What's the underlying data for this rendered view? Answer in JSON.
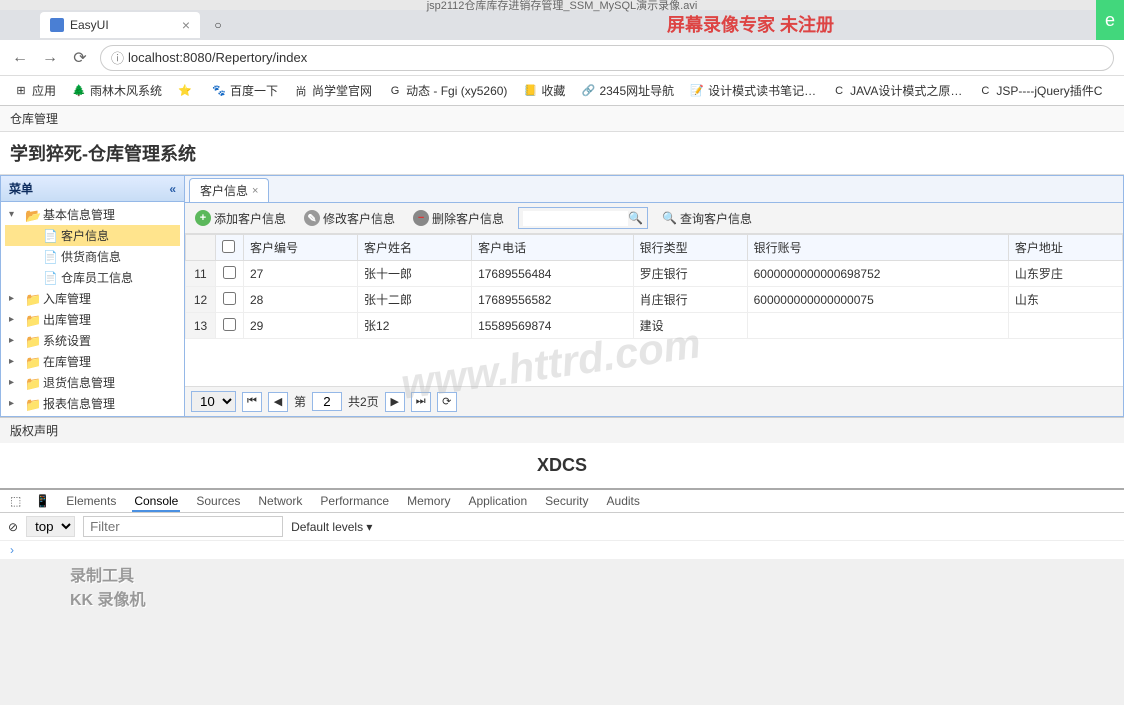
{
  "video_title": "jsp2112仓库库存进销存管理_SSM_MySQL演示录像.avi",
  "watermark_top": "屏幕录像专家  未注册",
  "browser": {
    "tab_title": "EasyUI",
    "url": "localhost:8080/Repertory/index"
  },
  "bookmarks": [
    {
      "icon": "⊞",
      "label": "应用"
    },
    {
      "icon": "🌲",
      "label": "雨林木风系统"
    },
    {
      "icon": "⭐",
      "label": ""
    },
    {
      "icon": "🐾",
      "label": "百度一下"
    },
    {
      "icon": "尚",
      "label": "尚学堂官网"
    },
    {
      "icon": "G",
      "label": "动态 - Fgi (xy5260)"
    },
    {
      "icon": "📒",
      "label": "收藏"
    },
    {
      "icon": "🔗",
      "label": "2345网址导航"
    },
    {
      "icon": "📝",
      "label": "设计模式读书笔记…"
    },
    {
      "icon": "C",
      "label": "JAVA设计模式之原…"
    },
    {
      "icon": "C",
      "label": "JSP----jQuery插件C"
    }
  ],
  "app_menu": "仓库管理",
  "app_title": "学到猝死-仓库管理系统",
  "sidebar": {
    "header": "菜单",
    "nodes": [
      {
        "level": 1,
        "toggle": "▾",
        "type": "folder-open",
        "label": "基本信息管理"
      },
      {
        "level": 2,
        "toggle": "",
        "type": "file",
        "label": "客户信息",
        "selected": true
      },
      {
        "level": 2,
        "toggle": "",
        "type": "file",
        "label": "供货商信息"
      },
      {
        "level": 2,
        "toggle": "",
        "type": "file",
        "label": "仓库员工信息"
      },
      {
        "level": 1,
        "toggle": "▸",
        "type": "folder-closed",
        "label": "入库管理"
      },
      {
        "level": 1,
        "toggle": "▸",
        "type": "folder-closed",
        "label": "出库管理"
      },
      {
        "level": 1,
        "toggle": "▸",
        "type": "folder-closed",
        "label": "系统设置"
      },
      {
        "level": 1,
        "toggle": "▸",
        "type": "folder-closed",
        "label": "在库管理"
      },
      {
        "level": 1,
        "toggle": "▸",
        "type": "folder-closed",
        "label": "退货信息管理"
      },
      {
        "level": 1,
        "toggle": "▸",
        "type": "folder-closed",
        "label": "报表信息管理"
      }
    ]
  },
  "content_tab": "客户信息",
  "toolbar": {
    "add": "添加客户信息",
    "edit": "修改客户信息",
    "del": "删除客户信息",
    "search": "查询客户信息"
  },
  "columns": [
    "客户编号",
    "客户姓名",
    "客户电话",
    "银行类型",
    "银行账号",
    "客户地址"
  ],
  "rows": [
    {
      "n": "11",
      "id": "27",
      "name": "张十一郎",
      "phone": "17689556484",
      "bank": "罗庄银行",
      "acct": "6000000000000698752",
      "addr": "山东罗庄"
    },
    {
      "n": "12",
      "id": "28",
      "name": "张十二郎",
      "phone": "17689556582",
      "bank": "肖庄银行",
      "acct": "600000000000000075",
      "addr": "山东"
    },
    {
      "n": "13",
      "id": "29",
      "name": "张12",
      "phone": "15589569874",
      "bank": "建设",
      "acct": "",
      "addr": ""
    }
  ],
  "pagination": {
    "page_size": "10",
    "page_label_prefix": "第",
    "page": "2",
    "total_label": "共2页"
  },
  "copyright": "版权声明",
  "footer_brand": "XDCS",
  "watermark_mid": "www.httrd.com",
  "watermark_bl1": "录制工具",
  "watermark_bl2": "KK 录像机",
  "devtools": {
    "tabs": [
      "Elements",
      "Console",
      "Sources",
      "Network",
      "Performance",
      "Memory",
      "Application",
      "Security",
      "Audits"
    ],
    "context": "top",
    "filter_placeholder": "Filter",
    "levels": "Default levels ▾"
  }
}
